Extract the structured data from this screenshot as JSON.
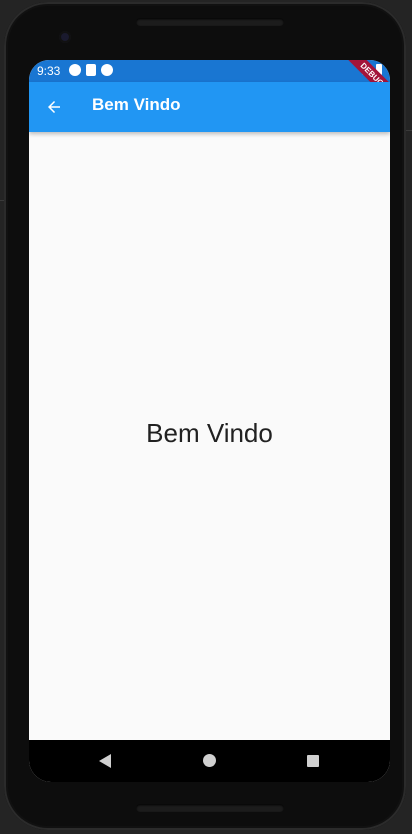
{
  "status_bar": {
    "time": "9:33",
    "left_icons": [
      "play-circle-icon",
      "sd-card-icon",
      "at-sign-icon"
    ],
    "right_icons": [
      "wifi-icon",
      "battery-icon"
    ]
  },
  "debug_banner": {
    "label": "DEBUG",
    "color": "#a3143a"
  },
  "app_bar": {
    "title": "Bem Vindo",
    "color": "#2196f3",
    "back_icon": "arrow-back-icon"
  },
  "body": {
    "text": "Bem Vindo"
  },
  "nav_bar": {
    "buttons": [
      "back-triangle-icon",
      "home-circle-icon",
      "recents-square-icon"
    ]
  }
}
